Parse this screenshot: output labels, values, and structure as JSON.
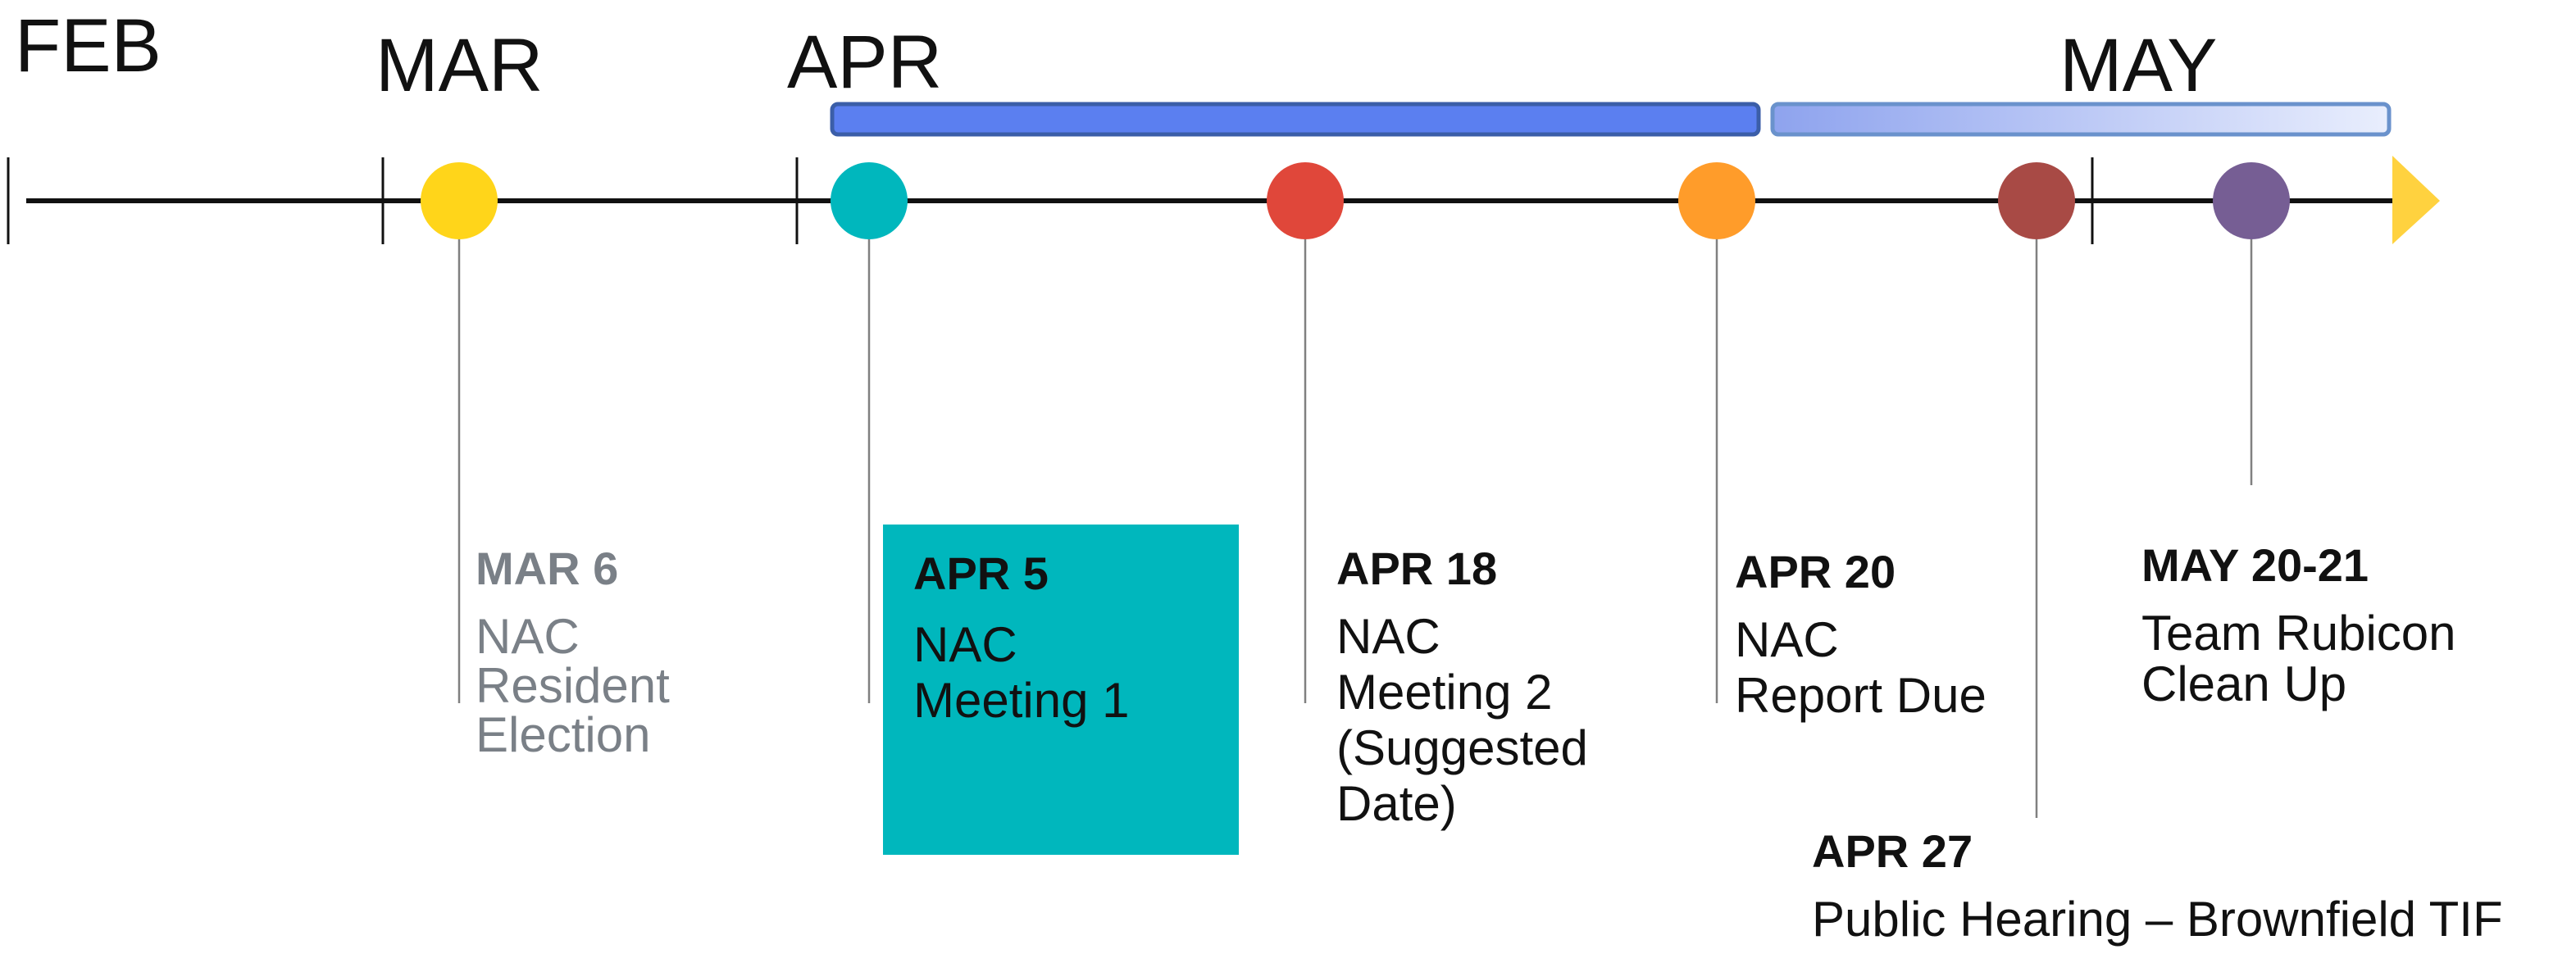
{
  "months": [
    {
      "key": "feb",
      "label": "FEB"
    },
    {
      "key": "mar",
      "label": "MAR"
    },
    {
      "key": "apr",
      "label": "APR"
    },
    {
      "key": "may",
      "label": "MAY"
    }
  ],
  "events": [
    {
      "key": "mar6",
      "date": "MAR 6",
      "lines": [
        "NAC",
        "Resident",
        "Election"
      ],
      "color": "#ffd51a",
      "muted": true
    },
    {
      "key": "apr5",
      "date": "APR 5",
      "lines": [
        "NAC",
        "Meeting 1"
      ],
      "color": "#00b7bd",
      "highlighted": true
    },
    {
      "key": "apr18",
      "date": "APR 18",
      "lines": [
        "NAC",
        "Meeting 2",
        "(Suggested",
        "Date)"
      ],
      "color": "#e0473a"
    },
    {
      "key": "apr20",
      "date": "APR 20",
      "lines": [
        "NAC",
        "Report Due"
      ],
      "color": "#ff9c2a"
    },
    {
      "key": "apr27",
      "date": "APR 27",
      "lines": [
        "Public Hearing – Brownfield TIF"
      ],
      "color": "#a84a45"
    },
    {
      "key": "may20",
      "date": "MAY 20-21",
      "lines": [
        "Team Rubicon",
        "Clean Up"
      ],
      "color": "#765e94"
    }
  ],
  "colors": {
    "axis": "#111111",
    "leader": "#808080",
    "arrow": "#ffd23f",
    "bar_solid": "#5b7ff0",
    "bar_solid_border": "#3b5ea8",
    "bar_gradient_start": "#8ea3ee",
    "bar_gradient_end": "#e9eefd",
    "bar_gradient_border": "#6a92cc",
    "highlight_box": "#00b7bd"
  }
}
